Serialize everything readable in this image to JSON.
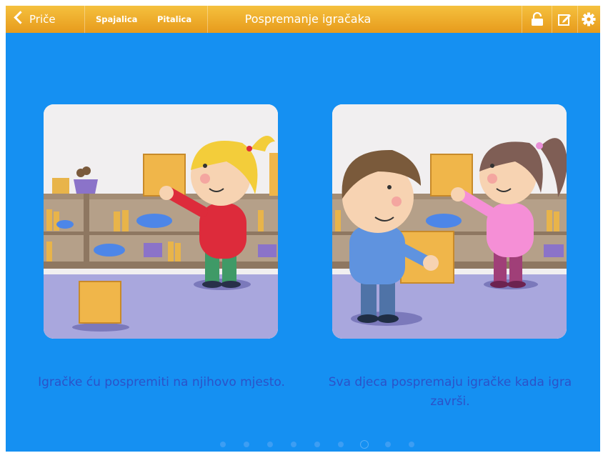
{
  "topbar": {
    "back_label": "Priče",
    "tabs": [
      "Spajalica",
      "Pitalica"
    ],
    "title": "Pospremanje igračaka",
    "icons": [
      "lock-open-icon",
      "edit-icon",
      "gear-icon"
    ]
  },
  "colors": {
    "background": "#1590f2",
    "topbar": "#efad2b",
    "caption": "#2c52c8"
  },
  "story": {
    "cards": [
      {
        "caption": "Igračke ću pospremiti na njihovo mjesto."
      },
      {
        "caption": "Sva djeca pospremaju igračke kada igra završi."
      }
    ]
  },
  "pagination": {
    "count": 9,
    "active_index": 6
  }
}
